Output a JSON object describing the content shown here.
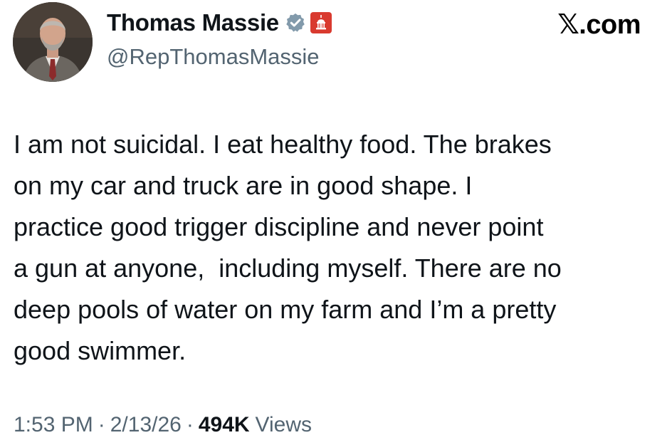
{
  "author": {
    "display_name": "Thomas Massie",
    "handle": "@RepThomasMassie",
    "avatar_icon": "profile-photo",
    "verified_icon": "verified-badge-icon",
    "affiliation_icon": "capitol-dome-icon",
    "verified_color": "#829aab",
    "affiliation_color": "#d93a2f"
  },
  "site_label": "𝕏.com",
  "tweet": {
    "lines": [
      "I am not suicidal. I eat healthy food. The brakes",
      "on my car and truck are in good shape. I",
      "practice good trigger discipline and never point",
      "a gun at anyone,  including myself. There are no",
      "deep pools of water on my farm and I’m a pretty",
      "good swimmer."
    ]
  },
  "meta": {
    "time": "1:53 PM",
    "separator": "·",
    "date": "2/13/26",
    "views_count": "494K",
    "views_label": "Views"
  }
}
